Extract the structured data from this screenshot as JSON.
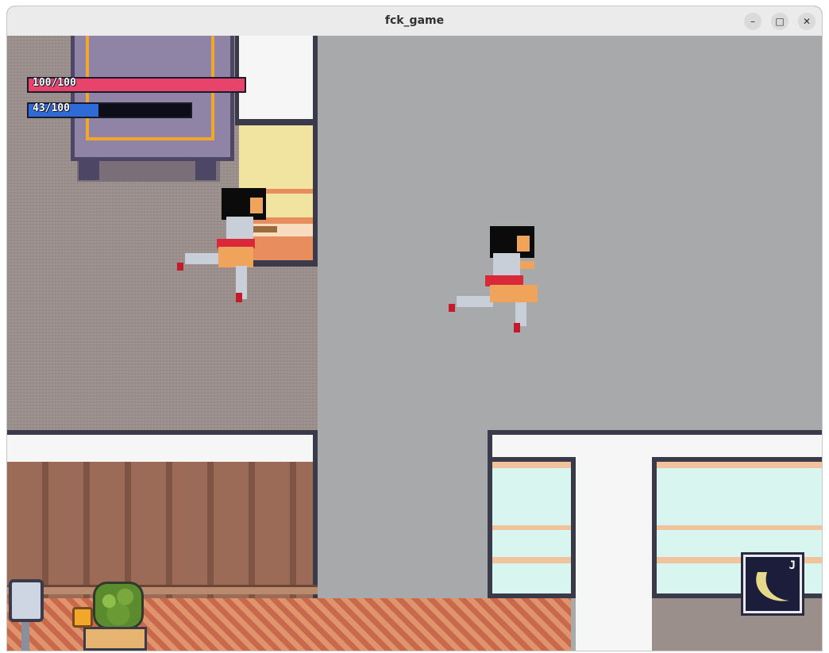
{
  "window": {
    "title": "fck_game",
    "controls": {
      "minimize": "–",
      "maximize": "□",
      "close": "✕"
    }
  },
  "hud": {
    "health": {
      "text": "100/100",
      "current": 100,
      "max": 100,
      "color": "#e8436a"
    },
    "mana": {
      "text": "43/100",
      "current": 43,
      "max": 100,
      "color": "#2f6bd6"
    }
  },
  "skill_slot": {
    "key": "J",
    "icon": "crescent-slash-icon"
  },
  "characters": [
    {
      "role": "player",
      "pose": "flying-kick"
    },
    {
      "role": "enemy",
      "pose": "flying-kick"
    }
  ],
  "colors": {
    "floor_gray": "#a7a9ab",
    "carpet_taupe": "#9b8f8c",
    "wall_white": "#f6f6f6",
    "outline": "#3a3a4a",
    "wood": "#9c6b58",
    "zigzag_rug": "#c8684c",
    "cabinet_purple": "#8f84a6",
    "gold_trim": "#f2a72b",
    "glass_cyan": "#d8f5ef",
    "stripe_peach": "#f0c39c"
  }
}
